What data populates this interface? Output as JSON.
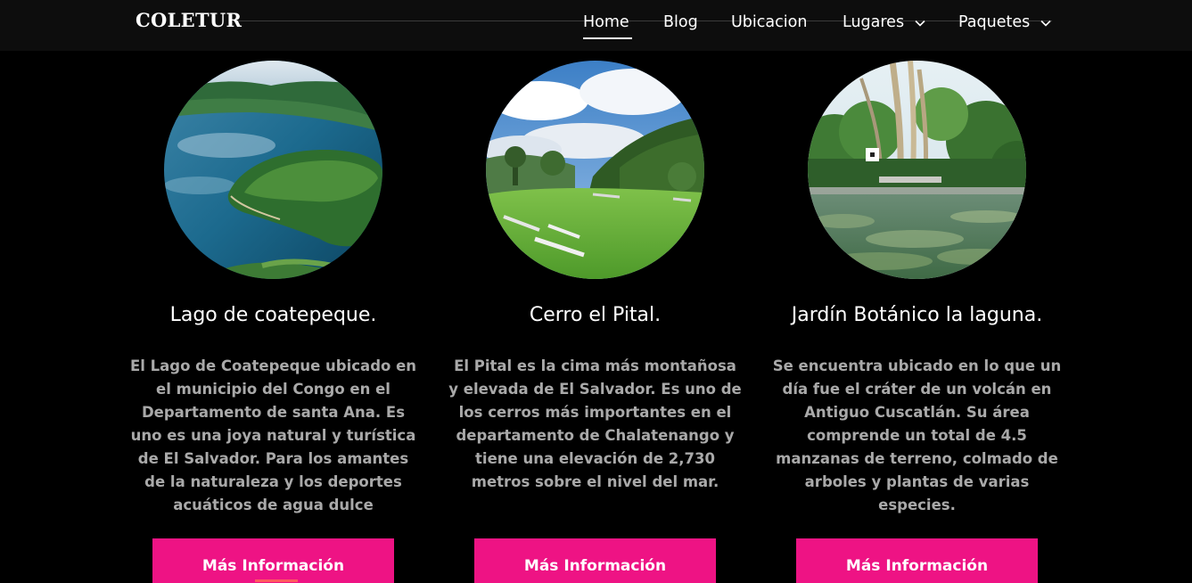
{
  "nav": {
    "brand": "COLETUR",
    "items": [
      {
        "label": "Home",
        "active": true,
        "dropdown": false
      },
      {
        "label": "Blog",
        "active": false,
        "dropdown": false
      },
      {
        "label": "Ubicacion",
        "active": false,
        "dropdown": false
      },
      {
        "label": "Lugares",
        "active": false,
        "dropdown": true,
        "icon": "chevron-down-icon"
      },
      {
        "label": "Paquetes",
        "active": false,
        "dropdown": true,
        "icon": "chevron-down-icon"
      }
    ]
  },
  "cards": [
    {
      "title": "Lago de coatepeque.",
      "description_lines": [
        "El Lago de Coatepeque ubicado en",
        "el municipio del Congo en el",
        "Departamento de santa Ana. Es",
        "uno es una joya natural y turística",
        "de El Salvador. Para los amantes",
        "de la naturaleza y los deportes",
        "acuáticos de agua dulce"
      ],
      "button_label": "Más Información"
    },
    {
      "title": "Cerro el Pital.",
      "description_lines": [
        "El Pital es la cima más montañosa",
        "y elevada de El Salvador. Es uno de",
        "los cerros más importantes en el",
        "departamento de Chalatenango y",
        "tiene una elevación de 2,730",
        "metros sobre el nivel del mar."
      ],
      "button_label": "Más Información"
    },
    {
      "title": "Jardín Botánico la laguna.",
      "description_lines": [
        "Se encuentra ubicado en lo que un",
        "día fue el cráter de un volcán en",
        "Antiguo Cuscatlán. Su área",
        "comprende un total de 4.5",
        "manzanas de terreno, colmado de",
        "arboles y plantas de varias",
        "especies."
      ],
      "button_label": "Más Información"
    }
  ],
  "colors": {
    "background": "#000000",
    "navbar": "#0d0d0d",
    "accent": "#ee1384",
    "text_primary": "#ffffff",
    "text_muted": "#a9a9a9"
  }
}
